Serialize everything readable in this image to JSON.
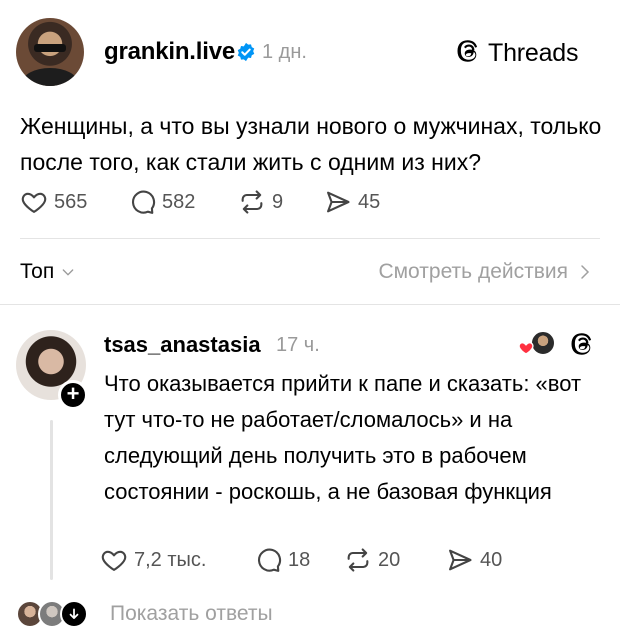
{
  "post": {
    "author": "grankin.live",
    "time": "1 дн.",
    "threads_brand": "Threads",
    "text": "Женщины, а что вы узнали нового о мужчинах, только после того, как стали жить с одним из них?",
    "likes": "565",
    "comments": "582",
    "reposts": "9",
    "shares": "45"
  },
  "sort": {
    "label": "Топ",
    "activity_link": "Смотреть действия"
  },
  "reply": {
    "author": "tsas_anastasia",
    "time": "17 ч.",
    "text": "Что оказывается прийти к папе и сказать: «вот тут что-то не работает/сломалось» и на следующий день получить это в рабочем состоянии - роскошь, а не базовая функция",
    "likes": "7,2 тыс.",
    "comments": "18",
    "reposts": "20",
    "shares": "40",
    "show_replies": "Показать ответы"
  },
  "colors": {
    "verified": "#0095f6",
    "muted": "#9a9a9a",
    "heart_red": "#ff3040"
  },
  "icons": [
    "verified-icon",
    "threads-logo-icon",
    "heart-icon",
    "comment-icon",
    "repost-icon",
    "share-icon",
    "chevron-down-icon",
    "chevron-right-icon",
    "follow-plus-icon",
    "arrow-down-icon"
  ]
}
